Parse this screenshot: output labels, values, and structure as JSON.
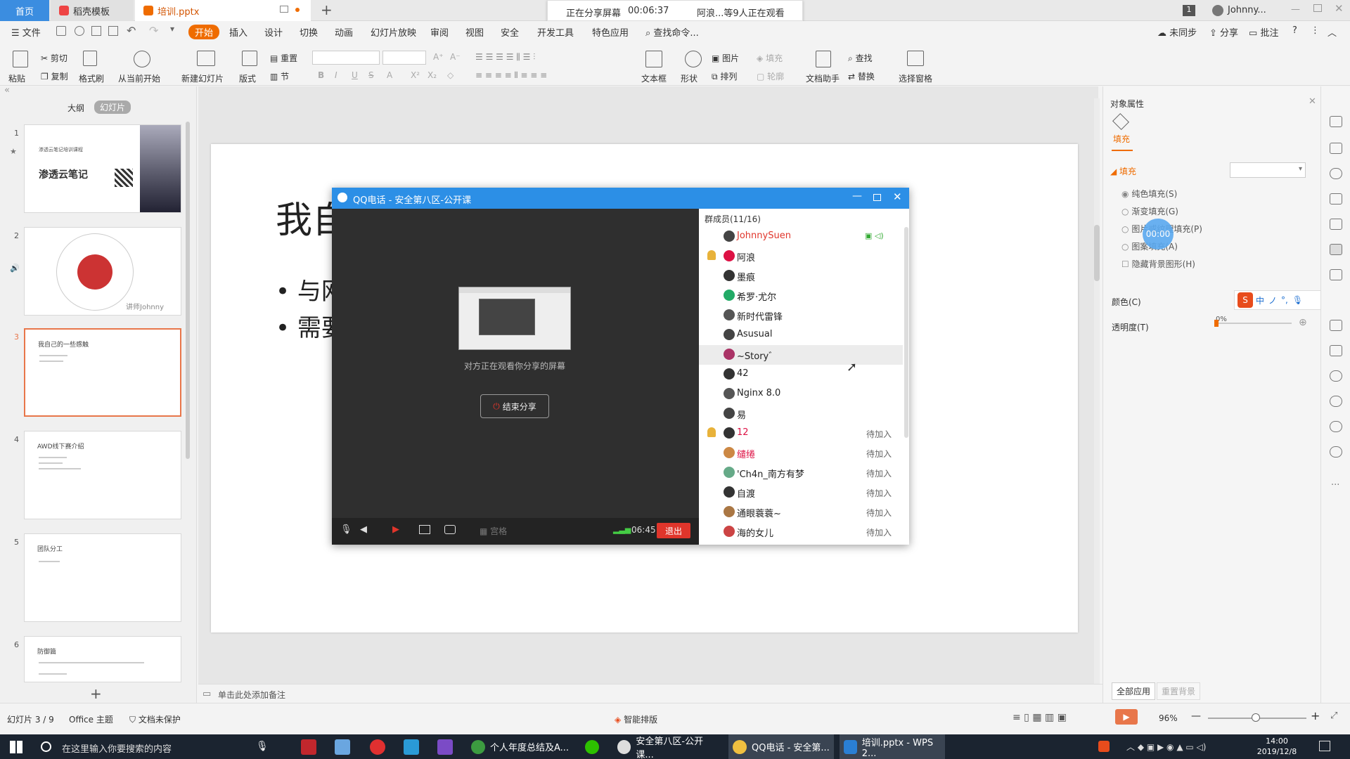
{
  "tabs": {
    "home": "首页",
    "daoke": "稻壳模板",
    "file": "培训.pptx"
  },
  "share": {
    "status": "正在分享屏幕",
    "time": "00:06:37",
    "viewers": "阿浪...等9人正在观看"
  },
  "user": {
    "badge": "1",
    "name": "Johnny..."
  },
  "menu": {
    "file": "文件",
    "items": [
      "开始",
      "插入",
      "设计",
      "切换",
      "动画",
      "幻灯片放映",
      "审阅",
      "视图",
      "安全",
      "开发工具",
      "特色应用"
    ],
    "search": "查找命令...",
    "sync": "未同步",
    "share": "分享",
    "comment": "批注"
  },
  "toolbar": {
    "paste": "粘贴",
    "cut": "剪切",
    "copy": "复制",
    "format": "格式刷",
    "play_from": "从当前开始",
    "new_slide": "新建幻灯片",
    "layout": "版式",
    "reset": "重置",
    "section": "节",
    "textbox": "文本框",
    "shape": "形状",
    "arrange": "排列",
    "picture": "图片",
    "fill": "填充",
    "outline": "轮廓",
    "doc_helper": "文档助手",
    "find": "查找",
    "replace": "替换",
    "select_pane": "选择窗格"
  },
  "left": {
    "outline_tab": "大纲",
    "slides_tab": "幻灯片",
    "slides": [
      {
        "num": "1",
        "title": "渗透云笔记培训课程",
        "logo": "渗透云笔记"
      },
      {
        "num": "2",
        "caption": "讲师Johnny"
      },
      {
        "num": "3",
        "title": "我自己的一些感触"
      },
      {
        "num": "4",
        "title": "AWD线下赛介绍"
      },
      {
        "num": "5",
        "title": "团队分工"
      },
      {
        "num": "6",
        "title": "防御篇"
      }
    ]
  },
  "slide": {
    "title": "我自",
    "bullets": [
      "与网",
      "需要"
    ]
  },
  "notes": "单击此处添加备注",
  "qq": {
    "title": "QQ电话 - 安全第八区-公开课",
    "watching": "对方正在观看你分享的屏幕",
    "end_share": "结束分享",
    "time": "06:45",
    "exit": "退出",
    "hang": "宫格",
    "members_title": "群成员(11/16)",
    "members": [
      {
        "name": "JohnnySuen",
        "status": ""
      },
      {
        "name": "阿浪",
        "status": ""
      },
      {
        "name": "墨痕",
        "status": ""
      },
      {
        "name": "希罗·尤尔",
        "status": ""
      },
      {
        "name": "新时代雷锋",
        "status": ""
      },
      {
        "name": "Asusual",
        "status": ""
      },
      {
        "name": "~Story゛",
        "status": ""
      },
      {
        "name": "42",
        "status": ""
      },
      {
        "name": "Nginx 8.0",
        "status": ""
      },
      {
        "name": "易",
        "status": ""
      },
      {
        "name": "12",
        "status": "待加入"
      },
      {
        "name": "缱绻",
        "status": "待加入"
      },
      {
        "name": "'Ch4n_南方有梦",
        "status": "待加入"
      },
      {
        "name": "自渡",
        "status": "待加入"
      },
      {
        "name": "通眼蓑蓑~",
        "status": "待加入"
      },
      {
        "name": "海的女儿",
        "status": "待加入"
      }
    ]
  },
  "right": {
    "header": "对象属性",
    "tab": "填充",
    "section": "填充",
    "options": [
      "纯色填充(S)",
      "渐变填充(G)",
      "图片或纹理填充(P)",
      "图案填充(A)"
    ],
    "hide_bg": "隐藏背景图形(H)",
    "color_label": "颜色(C)",
    "transparency_label": "透明度(T)",
    "transparency_value": "0%",
    "timer_bubble": "00:00",
    "apply_all": "全部应用",
    "reset_bg": "重置背景",
    "ime": [
      "中",
      "ノ",
      "°,"
    ]
  },
  "status": {
    "slide_count": "幻灯片 3 / 9",
    "theme": "Office 主题",
    "protect": "文档未保护",
    "smart": "智能排版",
    "zoom": "96%"
  },
  "taskbar": {
    "search": "在这里输入你要搜索的内容",
    "items": [
      "个人年度总结及A...",
      "安全第八区-公开课...",
      "QQ电话 - 安全第...",
      "培训.pptx - WPS 2..."
    ],
    "time": "14:00",
    "date": "2019/12/8"
  },
  "colors": {
    "accent": "#ef6c00",
    "qq_blue": "#2c8fe6",
    "exit_red": "#e0352b",
    "highlight": "#e8764a"
  }
}
